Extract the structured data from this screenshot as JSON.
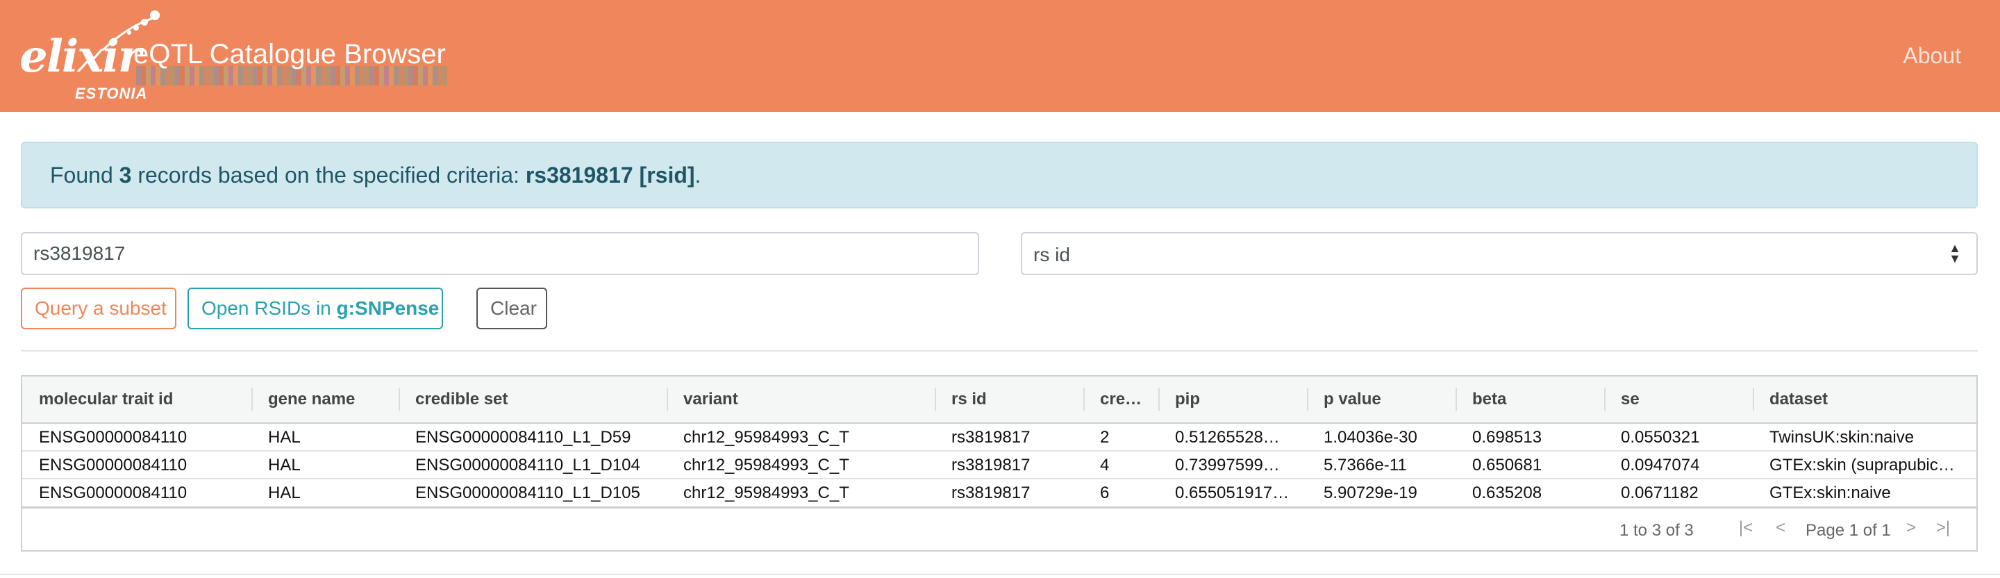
{
  "header": {
    "logo_word": "elixir",
    "logo_sub": "ESTONIA",
    "title": "eQTL Catalogue Browser",
    "about_label": "About",
    "bg_color": "#f0865b"
  },
  "alert": {
    "prefix": "Found",
    "count": "3",
    "middle": "records based on the specified criteria:",
    "criteria": "rs3819817 [rsid]",
    "suffix": "."
  },
  "search": {
    "value": "rs3819817",
    "select_value": "rs id",
    "caret_icon": "select-caret-icon"
  },
  "buttons": {
    "query_label": "Query a subset",
    "open_prefix": "Open RSIDs in",
    "open_bold": "g:SNPense",
    "clear_label": "Clear"
  },
  "table": {
    "columns": [
      "molecular trait id",
      "gene name",
      "credible set",
      "variant",
      "rs id",
      "cre…",
      "pip",
      "p value",
      "beta",
      "se",
      "dataset"
    ],
    "rows": [
      [
        "ENSG00000084110",
        "HAL",
        "ENSG00000084110_L1_D59",
        "chr12_95984993_C_T",
        "rs3819817",
        "2",
        "0.51265528…",
        "1.04036e-30",
        "0.698513",
        "0.0550321",
        "TwinsUK:skin:naive"
      ],
      [
        "ENSG00000084110",
        "HAL",
        "ENSG00000084110_L1_D104",
        "chr12_95984993_C_T",
        "rs3819817",
        "4",
        "0.73997599…",
        "5.7366e-11",
        "0.650681",
        "0.0947074",
        "GTEx:skin (suprapubic…"
      ],
      [
        "ENSG00000084110",
        "HAL",
        "ENSG00000084110_L1_D105",
        "chr12_95984993_C_T",
        "rs3819817",
        "6",
        "0.655051917…",
        "5.90729e-19",
        "0.635208",
        "0.0671182",
        "GTEx:skin:naive"
      ]
    ],
    "footer": {
      "count_text": "1 to 3 of 3",
      "page_text": "Page 1 of 1",
      "icons": [
        "first-page-icon",
        "previous-page-icon",
        "next-page-icon",
        "last-page-icon"
      ]
    }
  }
}
